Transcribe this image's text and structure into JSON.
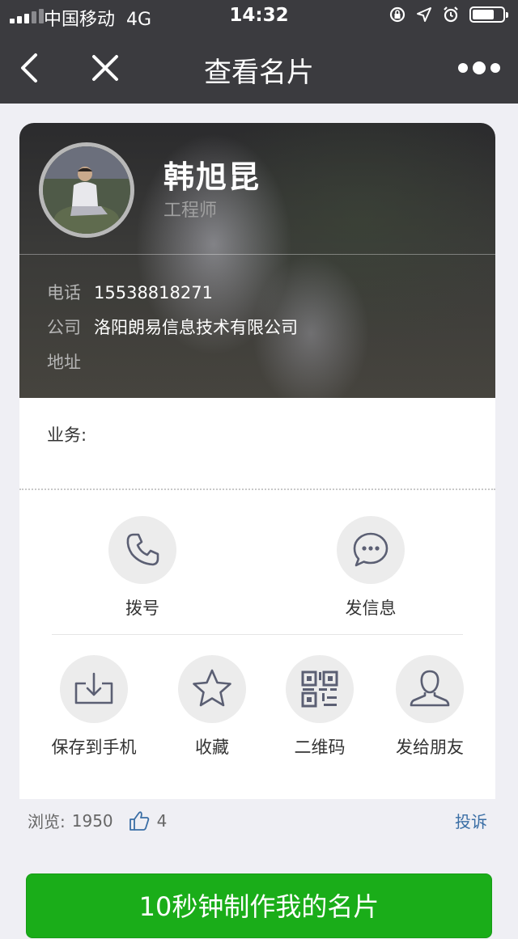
{
  "status_bar": {
    "carrier": "中国移动",
    "network": "4G",
    "time": "14:32"
  },
  "nav": {
    "title": "查看名片"
  },
  "card": {
    "name": "韩旭昆",
    "job_title": "工程师",
    "phone_label": "电话",
    "phone": "15538818271",
    "company_label": "公司",
    "company": "洛阳朗易信息技术有限公司",
    "address_label": "地址",
    "address": "",
    "business_label": "业务:"
  },
  "actions": {
    "call": "拨号",
    "message": "发信息",
    "save": "保存到手机",
    "favorite": "收藏",
    "qrcode": "二维码",
    "send_friend": "发给朋友"
  },
  "stats": {
    "views_label": "浏览:",
    "views": "1950",
    "likes": "4",
    "complain": "投诉"
  },
  "cta": {
    "make_card": "10秒钟制作我的名片"
  },
  "colors": {
    "header_bg": "#3b3b3f",
    "cta_green": "#1aad19",
    "link_blue": "#3a6ea5"
  }
}
